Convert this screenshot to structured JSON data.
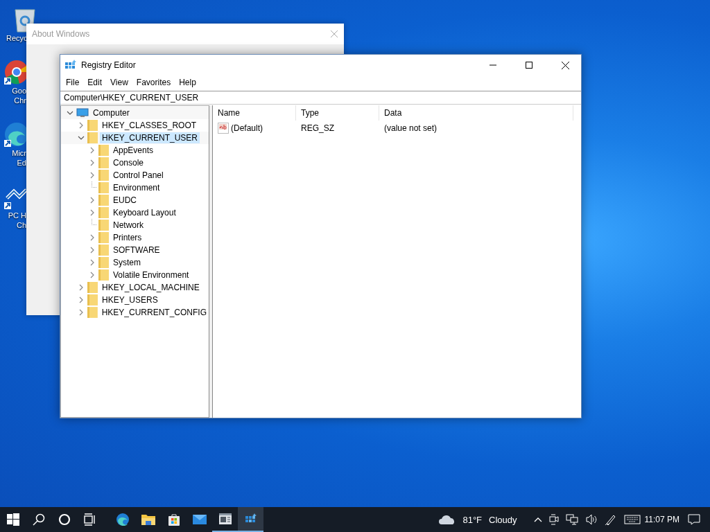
{
  "desktop_icons": [
    {
      "kind": "recycle-bin",
      "lines": [
        "Recyc"
      ]
    },
    {
      "kind": "chrome",
      "lines": [
        "Goo",
        "Chr"
      ]
    },
    {
      "kind": "edge",
      "lines": [
        "Micr",
        "Ed"
      ]
    },
    {
      "kind": "pc-health",
      "lines": [
        "PC H",
        "Ch"
      ]
    }
  ],
  "background_window": {
    "title": "About Windows"
  },
  "window": {
    "title": "Registry Editor",
    "menu": [
      "File",
      "Edit",
      "View",
      "Favorites",
      "Help"
    ],
    "address": "Computer\\HKEY_CURRENT_USER",
    "tree": [
      {
        "label": "Computer",
        "kind": "computer",
        "leaf": false,
        "expanded": true,
        "selected": false,
        "children": [
          {
            "label": "HKEY_CLASSES_ROOT",
            "kind": "folder",
            "leaf": false,
            "expanded": false,
            "selected": false
          },
          {
            "label": "HKEY_CURRENT_USER",
            "kind": "folder",
            "leaf": false,
            "expanded": true,
            "selected": true,
            "children": [
              {
                "label": "AppEvents",
                "kind": "folder",
                "leaf": false,
                "expanded": false,
                "selected": false
              },
              {
                "label": "Console",
                "kind": "folder",
                "leaf": false,
                "expanded": false,
                "selected": false
              },
              {
                "label": "Control Panel",
                "kind": "folder",
                "leaf": false,
                "expanded": false,
                "selected": false
              },
              {
                "label": "Environment",
                "kind": "folder",
                "leaf": true,
                "expanded": false,
                "selected": false
              },
              {
                "label": "EUDC",
                "kind": "folder",
                "leaf": false,
                "expanded": false,
                "selected": false
              },
              {
                "label": "Keyboard Layout",
                "kind": "folder",
                "leaf": false,
                "expanded": false,
                "selected": false
              },
              {
                "label": "Network",
                "kind": "folder",
                "leaf": true,
                "expanded": false,
                "selected": false
              },
              {
                "label": "Printers",
                "kind": "folder",
                "leaf": false,
                "expanded": false,
                "selected": false
              },
              {
                "label": "SOFTWARE",
                "kind": "folder",
                "leaf": false,
                "expanded": false,
                "selected": false
              },
              {
                "label": "System",
                "kind": "folder",
                "leaf": false,
                "expanded": false,
                "selected": false
              },
              {
                "label": "Volatile Environment",
                "kind": "folder",
                "leaf": false,
                "expanded": false,
                "selected": false
              }
            ]
          },
          {
            "label": "HKEY_LOCAL_MACHINE",
            "kind": "folder",
            "leaf": false,
            "expanded": false,
            "selected": false
          },
          {
            "label": "HKEY_USERS",
            "kind": "folder",
            "leaf": false,
            "expanded": false,
            "selected": false
          },
          {
            "label": "HKEY_CURRENT_CONFIG",
            "kind": "folder",
            "leaf": false,
            "expanded": false,
            "selected": false
          }
        ]
      }
    ],
    "columns": [
      "Name",
      "Type",
      "Data"
    ],
    "values": [
      {
        "name": "(Default)",
        "type": "REG_SZ",
        "data": "(value not set)"
      }
    ]
  },
  "taskbar": {
    "apps": [
      {
        "kind": "start",
        "running": false,
        "active": false
      },
      {
        "kind": "search",
        "running": false,
        "active": false
      },
      {
        "kind": "cortana",
        "running": false,
        "active": false
      },
      {
        "kind": "task-view",
        "running": false,
        "active": false
      },
      {
        "kind": "edge",
        "running": false,
        "active": false
      },
      {
        "kind": "explorer",
        "running": false,
        "active": false
      },
      {
        "kind": "store",
        "running": false,
        "active": false
      },
      {
        "kind": "mail",
        "running": false,
        "active": false
      },
      {
        "kind": "window",
        "running": true,
        "active": false
      },
      {
        "kind": "registry",
        "running": true,
        "active": true
      }
    ],
    "weather": {
      "temperature": "81°F",
      "condition": "Cloudy"
    },
    "tray": [
      {
        "kind": "chevron"
      },
      {
        "kind": "meet"
      },
      {
        "kind": "network"
      },
      {
        "kind": "volume"
      },
      {
        "kind": "pen"
      },
      {
        "kind": "keyboard"
      }
    ],
    "clock": "11:07 PM"
  }
}
